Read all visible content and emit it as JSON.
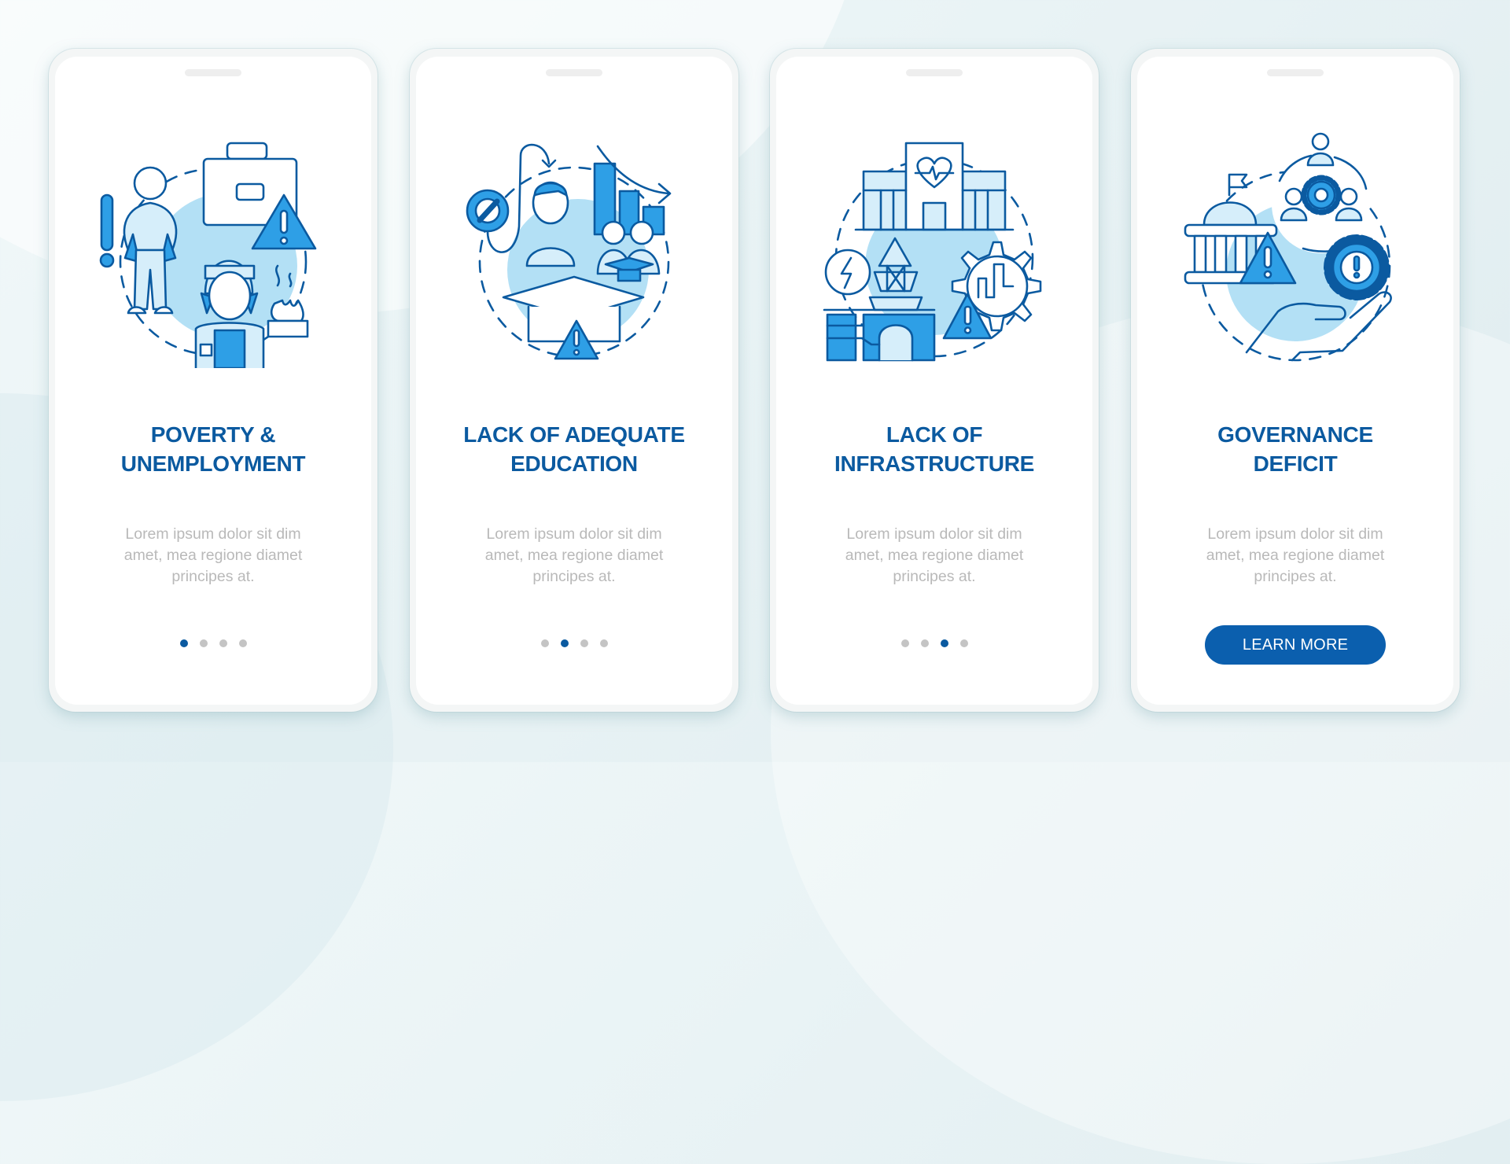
{
  "colors": {
    "primary": "#0b5aa0",
    "accent_blue": "#2e9fe6",
    "light_blue": "#b3e0f5",
    "button": "#0b5fae",
    "body_text": "#b9b9b9",
    "dot_inactive": "#c4c4c4"
  },
  "screens": [
    {
      "illustration": "poverty-unemployment-illustration",
      "title_lines": [
        "POVERTY &",
        "UNEMPLOYMENT"
      ],
      "body_lines": [
        "Lorem ipsum dolor sit dim",
        "amet, mea regione diamet",
        "principes at."
      ],
      "pagination": {
        "total": 4,
        "active": 1
      }
    },
    {
      "illustration": "lack-of-education-illustration",
      "title_lines": [
        "LACK OF ADEQUATE",
        "EDUCATION"
      ],
      "body_lines": [
        "Lorem ipsum dolor sit dim",
        "amet, mea regione diamet",
        "principes at."
      ],
      "pagination": {
        "total": 4,
        "active": 2
      }
    },
    {
      "illustration": "lack-of-infrastructure-illustration",
      "title_lines": [
        "LACK OF",
        "INFRASTRUCTURE"
      ],
      "body_lines": [
        "Lorem ipsum dolor sit dim",
        "amet, mea regione diamet",
        "principes at."
      ],
      "pagination": {
        "total": 4,
        "active": 3
      }
    },
    {
      "illustration": "governance-deficit-illustration",
      "title_lines": [
        "GOVERNANCE",
        "DEFICIT"
      ],
      "body_lines": [
        "Lorem ipsum dolor sit dim",
        "amet, mea regione diamet",
        "principes at."
      ],
      "button_label": "LEARN MORE"
    }
  ]
}
